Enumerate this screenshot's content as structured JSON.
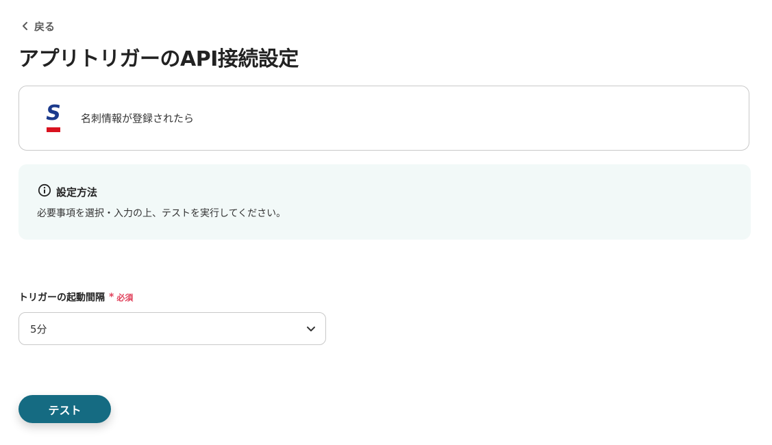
{
  "nav": {
    "back_label": "戻る"
  },
  "page": {
    "title": "アプリトリガーのAPI接続設定"
  },
  "trigger": {
    "app_icon": "sansan-logo",
    "label": "名刺情報が登録されたら"
  },
  "info": {
    "icon": "info-icon",
    "title": "設定方法",
    "text": "必要事項を選択・入力の上、テストを実行してください。"
  },
  "form": {
    "interval_label": "トリガーの起動間隔",
    "required_mark": "*",
    "required_text": "必須",
    "interval_value": "5分"
  },
  "actions": {
    "test_label": "テスト"
  },
  "colors": {
    "primary": "#156b82",
    "required": "#e0405a",
    "info_bg": "#f2f9f8",
    "logo_blue": "#1b3a8c",
    "logo_red": "#d9121f"
  }
}
